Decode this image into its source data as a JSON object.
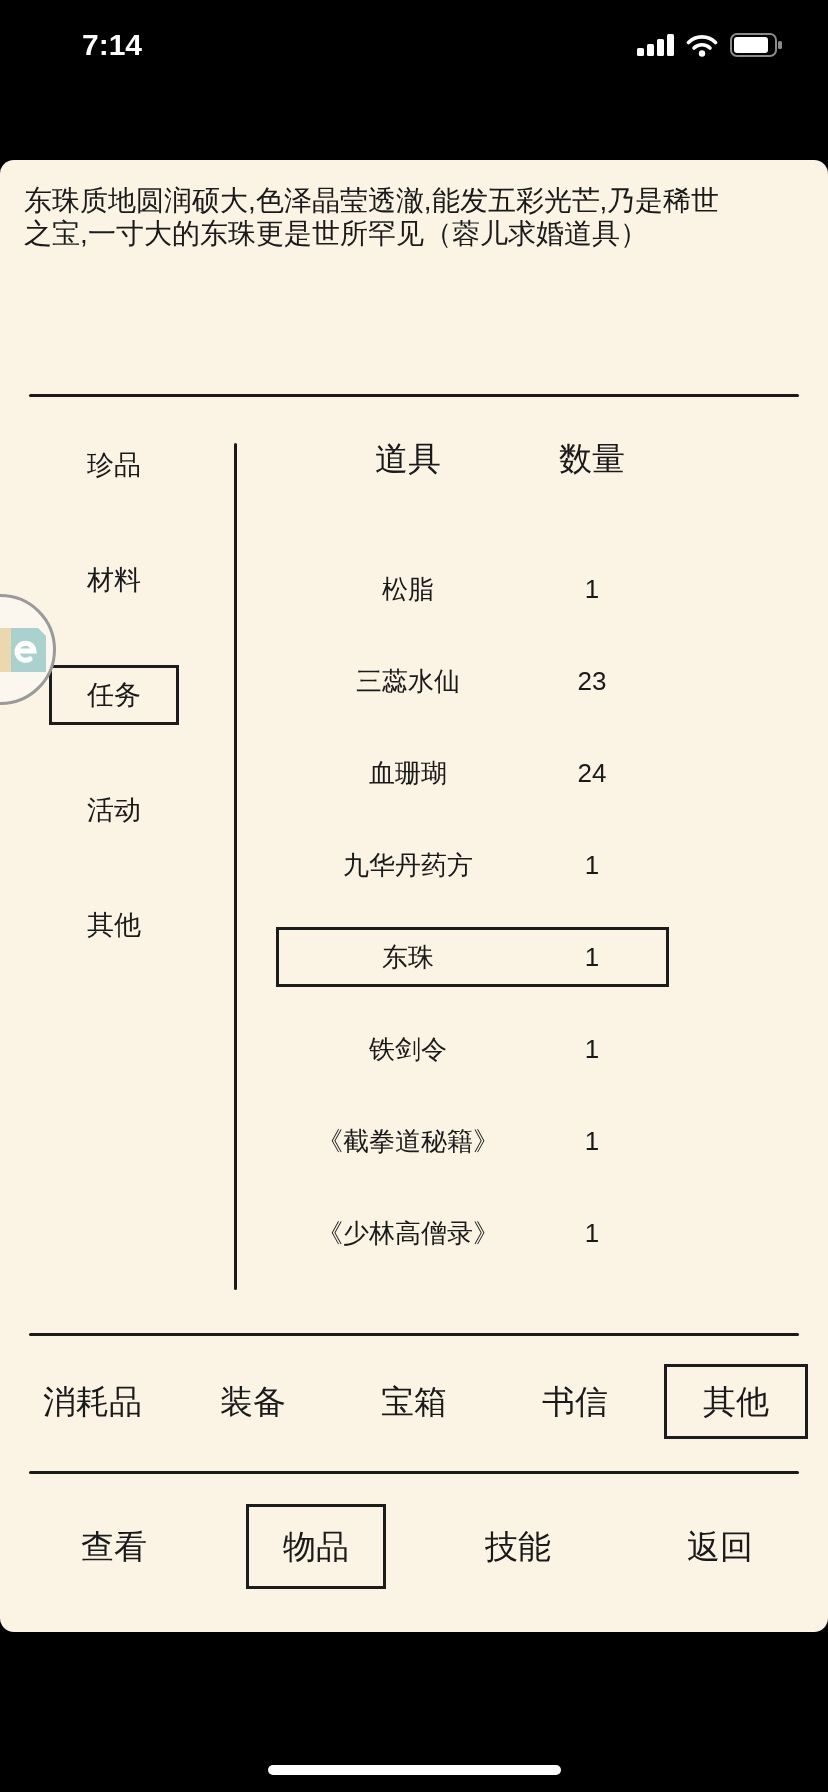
{
  "status_bar": {
    "time": "7:14"
  },
  "description": "东珠质地圆润硕大,色泽晶莹透澈,能发五彩光芒,乃是稀世之宝,一寸大的东珠更是世所罕见（蓉儿求婚道具）",
  "categories": [
    {
      "label": "珍品",
      "selected": false
    },
    {
      "label": "材料",
      "selected": false
    },
    {
      "label": "任务",
      "selected": true
    },
    {
      "label": "活动",
      "selected": false
    },
    {
      "label": "其他",
      "selected": false
    }
  ],
  "table": {
    "columns": [
      "道具",
      "数量"
    ],
    "rows": [
      {
        "item": "松脂",
        "count": "1",
        "selected": false
      },
      {
        "item": "三蕊水仙",
        "count": "23",
        "selected": false
      },
      {
        "item": "血珊瑚",
        "count": "24",
        "selected": false
      },
      {
        "item": "九华丹药方",
        "count": "1",
        "selected": false
      },
      {
        "item": "东珠",
        "count": "1",
        "selected": true
      },
      {
        "item": "铁剑令",
        "count": "1",
        "selected": false
      },
      {
        "item": "《截拳道秘籍》",
        "count": "1",
        "selected": false
      },
      {
        "item": "《少林高僧录》",
        "count": "1",
        "selected": false
      }
    ]
  },
  "item_types": [
    {
      "label": "消耗品",
      "selected": false
    },
    {
      "label": "装备",
      "selected": false
    },
    {
      "label": "宝箱",
      "selected": false
    },
    {
      "label": "书信",
      "selected": false
    },
    {
      "label": "其他",
      "selected": true
    }
  ],
  "nav": [
    {
      "label": "查看",
      "selected": false
    },
    {
      "label": "物品",
      "selected": true
    },
    {
      "label": "技能",
      "selected": false
    },
    {
      "label": "返回",
      "selected": false
    }
  ]
}
